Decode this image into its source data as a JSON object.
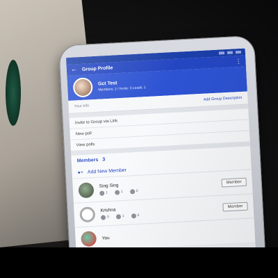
{
  "screen": {
    "title": "Group Profile",
    "back_icon": "back-arrow-icon",
    "menu_icon": "kebab-menu-icon",
    "group": {
      "name": "Gct Test",
      "meta": "Members: 2 / Invite: 3 Leads: 1"
    },
    "description_row": {
      "label": "Your info",
      "action": "Add Group Description"
    },
    "menu": [
      {
        "label": "Invite to Group via Link"
      },
      {
        "label": "New poll"
      },
      {
        "label": "View polls"
      }
    ],
    "members_heading": "Members",
    "members_count": "3",
    "add_member_label": "Add New Member",
    "members": [
      {
        "name": "Sing Sing",
        "stats": [
          "1",
          "1",
          "0"
        ],
        "role": "Member"
      },
      {
        "name": "Krishna",
        "stats": [
          "0",
          "1",
          "0"
        ],
        "role": "Member"
      },
      {
        "name": "You",
        "stats": [
          "",
          "",
          ""
        ],
        "role": ""
      }
    ]
  },
  "colors": {
    "accent": "#2446c2",
    "header": "#2d53d3"
  }
}
